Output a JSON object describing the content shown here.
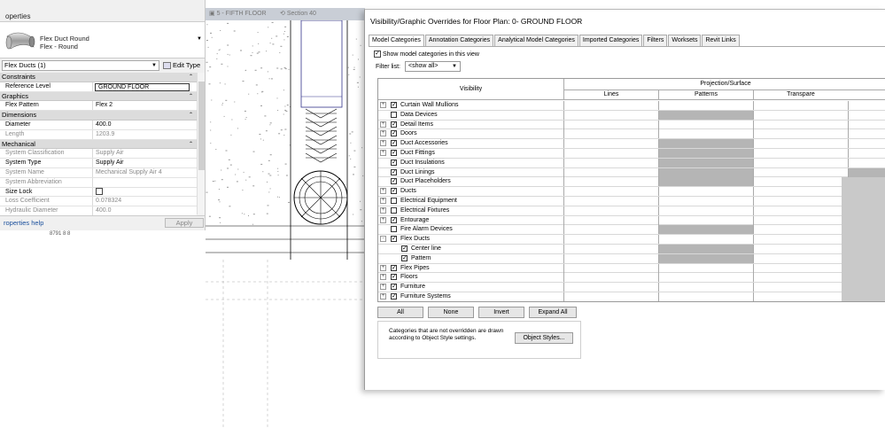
{
  "properties": {
    "title": "operties",
    "type_family": "Flex Duct Round",
    "type_name": "Flex - Round",
    "selection": "Flex Ducts (1)",
    "edit_type": "Edit Type",
    "sections": [
      {
        "name": "Constraints",
        "rows": [
          {
            "key": "Reference Level",
            "value": "GROUND FLOOR",
            "style": "box"
          }
        ]
      },
      {
        "name": "Graphics",
        "rows": [
          {
            "key": "Flex Pattern",
            "value": "Flex 2"
          }
        ]
      },
      {
        "name": "Dimensions",
        "rows": [
          {
            "key": "Diameter",
            "value": "400.0"
          },
          {
            "key": "Length",
            "value": "1203.9",
            "dim": true
          }
        ]
      },
      {
        "name": "Mechanical",
        "rows": [
          {
            "key": "System Classification",
            "value": "Supply Air",
            "dim": true
          },
          {
            "key": "System Type",
            "value": "Supply Air"
          },
          {
            "key": "System Name",
            "value": "Mechanical Supply Air 4",
            "dim": true
          },
          {
            "key": "System Abbreviation",
            "value": "",
            "dim": true
          },
          {
            "key": "Size Lock",
            "value": "",
            "style": "checkbox"
          },
          {
            "key": "Loss Coefficient",
            "value": "0.078324",
            "dim": true
          },
          {
            "key": "Hydraulic Diameter",
            "value": "400.0",
            "dim": true
          }
        ]
      }
    ],
    "help_link": "roperties help",
    "apply": "Apply"
  },
  "view": {
    "tabs": [
      "5 - FIFTH FLOOR",
      "Section 40"
    ],
    "fragment": "8791 8  8"
  },
  "dialog": {
    "title": "Visibility/Graphic Overrides for Floor Plan: 0- GROUND FLOOR",
    "tabs": [
      "Model Categories",
      "Annotation Categories",
      "Analytical Model Categories",
      "Imported Categories",
      "Filters",
      "Worksets",
      "Revit Links"
    ],
    "show_label": "Show model categories in this view",
    "filter_label": "Filter list:",
    "filter_value": "<show all>",
    "header": {
      "visibility": "Visibility",
      "projection": "Projection/Surface",
      "lines": "Lines",
      "patterns": "Patterns",
      "transparency": "Transpare"
    },
    "rows": [
      {
        "name": "Curtain Wall Mullions",
        "checked": true,
        "expand": "+",
        "pattern_gray": false,
        "right_gray": false
      },
      {
        "name": "Data Devices",
        "checked": false,
        "expand": "",
        "pattern_gray": true,
        "right_gray": false
      },
      {
        "name": "Detail Items",
        "checked": true,
        "expand": "+",
        "pattern_gray": false,
        "right_gray": false
      },
      {
        "name": "Doors",
        "checked": true,
        "expand": "+",
        "pattern_gray": false,
        "right_gray": false
      },
      {
        "name": "Duct Accessories",
        "checked": true,
        "expand": "+",
        "pattern_gray": true,
        "right_gray": false
      },
      {
        "name": "Duct Fittings",
        "checked": true,
        "expand": "+",
        "pattern_gray": true,
        "right_gray": false
      },
      {
        "name": "Duct Insulations",
        "checked": true,
        "expand": "",
        "pattern_gray": true,
        "right_gray": false
      },
      {
        "name": "Duct Linings",
        "checked": true,
        "expand": "",
        "pattern_gray": true,
        "right_gray": true
      },
      {
        "name": "Duct Placeholders",
        "checked": true,
        "expand": "",
        "pattern_gray": true,
        "right_gray": true
      },
      {
        "name": "Ducts",
        "checked": true,
        "expand": "+",
        "pattern_gray": false,
        "right_gray": true
      },
      {
        "name": "Electrical Equipment",
        "checked": false,
        "expand": "+",
        "pattern_gray": false,
        "right_gray": true
      },
      {
        "name": "Electrical Fixtures",
        "checked": false,
        "expand": "+",
        "pattern_gray": false,
        "right_gray": true
      },
      {
        "name": "Entourage",
        "checked": true,
        "expand": "+",
        "pattern_gray": false,
        "right_gray": true
      },
      {
        "name": "Fire Alarm Devices",
        "checked": false,
        "expand": "",
        "pattern_gray": true,
        "right_gray": true
      },
      {
        "name": "Flex Ducts",
        "checked": true,
        "expand": "-",
        "pattern_gray": false,
        "right_gray": true
      },
      {
        "name": "Center line",
        "checked": true,
        "expand": "",
        "indent": true,
        "pattern_gray": true,
        "right_gray": true
      },
      {
        "name": "Pattern",
        "checked": true,
        "expand": "",
        "indent": true,
        "pattern_gray": true,
        "right_gray": true
      },
      {
        "name": "Flex Pipes",
        "checked": true,
        "expand": "+",
        "pattern_gray": false,
        "right_gray": true
      },
      {
        "name": "Floors",
        "checked": true,
        "expand": "+",
        "pattern_gray": false,
        "right_gray": false
      },
      {
        "name": "Furniture",
        "checked": true,
        "expand": "+",
        "pattern_gray": false,
        "right_gray": true
      },
      {
        "name": "Furniture Systems",
        "checked": true,
        "expand": "+",
        "pattern_gray": false,
        "right_gray": true
      }
    ],
    "buttons": [
      "All",
      "None",
      "Invert",
      "Expand All"
    ],
    "note": "Categories that are not overridden are drawn according to Object Style settings.",
    "object_styles": "Object Styles..."
  }
}
